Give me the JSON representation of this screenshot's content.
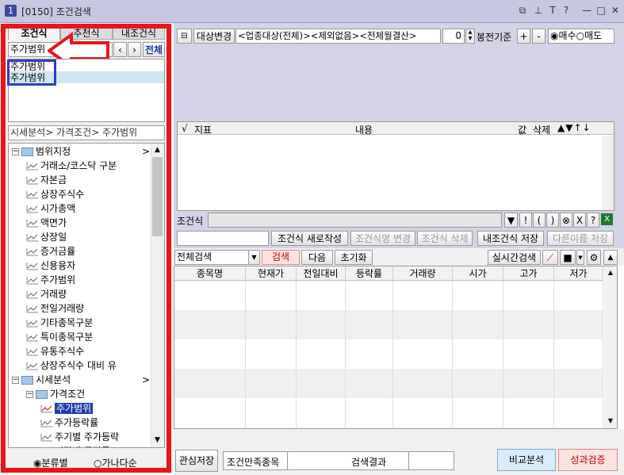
{
  "window": {
    "number": "1",
    "code": "[0150]",
    "title": "조건검색"
  },
  "left": {
    "tabs": [
      "조건식",
      "추천식",
      "내조건식"
    ],
    "search_value": "주가범위",
    "enter_label": "전체",
    "results": [
      "주가범위",
      "주가범위"
    ],
    "breadcrumb": "시세분석> 가격조건> 주가범위",
    "tree": [
      {
        "label": "범위지정",
        "level": 0,
        "type": "folder",
        "suffix": ">"
      },
      {
        "label": "거래소/코스닥 구분",
        "level": 1,
        "type": "leaf"
      },
      {
        "label": "자본금",
        "level": 1,
        "type": "leaf"
      },
      {
        "label": "상장주식수",
        "level": 1,
        "type": "leaf"
      },
      {
        "label": "시가총액",
        "level": 1,
        "type": "leaf"
      },
      {
        "label": "액면가",
        "level": 1,
        "type": "leaf"
      },
      {
        "label": "상장일",
        "level": 1,
        "type": "leaf"
      },
      {
        "label": "증거금률",
        "level": 1,
        "type": "leaf"
      },
      {
        "label": "신용융자",
        "level": 1,
        "type": "leaf"
      },
      {
        "label": "주가범위",
        "level": 1,
        "type": "leaf"
      },
      {
        "label": "거래량",
        "level": 1,
        "type": "leaf"
      },
      {
        "label": "전일거래량",
        "level": 1,
        "type": "leaf"
      },
      {
        "label": "기타종목구분",
        "level": 1,
        "type": "leaf"
      },
      {
        "label": "특이종목구분",
        "level": 1,
        "type": "leaf"
      },
      {
        "label": "유통주식수",
        "level": 1,
        "type": "leaf"
      },
      {
        "label": "상장주식수 대비 유",
        "level": 1,
        "type": "leaf"
      },
      {
        "label": "시세분석",
        "level": 0,
        "type": "folder",
        "suffix": ">"
      },
      {
        "label": "가격조건",
        "level": 1,
        "type": "folder"
      },
      {
        "label": "주가범위",
        "level": 2,
        "type": "leaf",
        "selected": true
      },
      {
        "label": "주가등락률",
        "level": 2,
        "type": "leaf"
      },
      {
        "label": "주기별 주가등락",
        "level": 2,
        "type": "leaf"
      },
      {
        "label": "기간내 등락률",
        "level": 2,
        "type": "leaf"
      }
    ],
    "radio_category": "분류별",
    "radio_alpha": "가나다순"
  },
  "right": {
    "target_button": "대상변경",
    "target_text": "<업종대상(전체)><제외없음><전체월결산>",
    "bong_value": "0",
    "bong_label": "봉전기준",
    "plus": "+",
    "minus": "-",
    "radio_buy": "매수",
    "radio_sell": "매도",
    "cond_header": {
      "check": "√",
      "index": "지표",
      "content": "내용",
      "value": "값",
      "delete": "삭제",
      "arrows": "▲▼↑↓"
    },
    "formula_label": "조건식",
    "formula_buttons": [
      "!",
      "(",
      ")",
      "⊗",
      "X",
      "?"
    ],
    "actions": {
      "new": "조건식 새로작성",
      "rename": "조건식명 변경",
      "delete": "조건식 삭제",
      "save": "내조건식 저장",
      "save_as": "다른이름 저장"
    },
    "search_mode": "전체검색",
    "search_btn": "검색",
    "next_btn": "다음",
    "reset_btn": "초기화",
    "realtime_btn": "실시간검색",
    "columns": [
      "종목명",
      "현재가",
      "전일대비",
      "등락률",
      "거래량",
      "시가",
      "고가",
      "저가"
    ],
    "footer": {
      "watch": "관심저장",
      "cond_stocks": "조건만족종목",
      "results_label": "검색결과",
      "compare": "비교분석",
      "perf": "성과검증"
    }
  },
  "colors": {
    "accent_red": "#e8151b",
    "highlight_blue": "#2e3ec4",
    "titlebar": "#c7c6e3",
    "panel_purple": "#d3d2e6"
  }
}
